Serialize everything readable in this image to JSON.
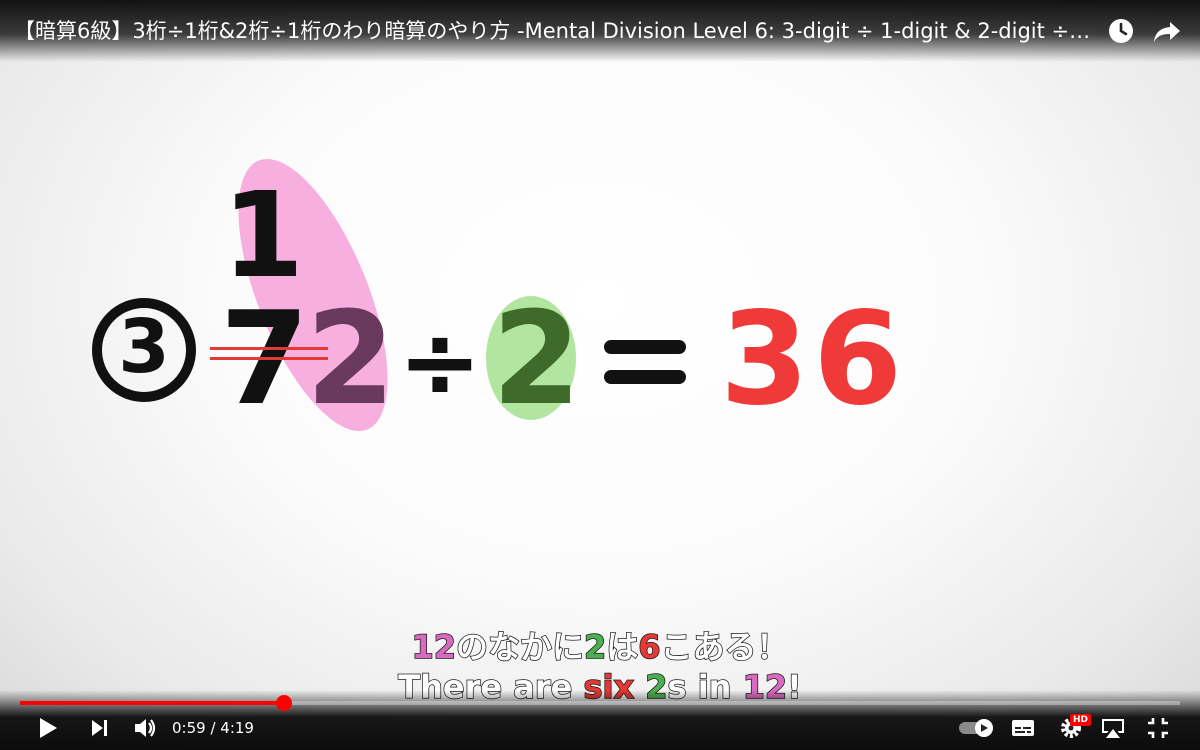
{
  "video": {
    "title": "【暗算6級】3桁÷1桁&2桁÷1桁のわり暗算のやり方 -Mental Division Level 6: 3-digit ÷ 1-digit & 2-digit ÷ 1-di..."
  },
  "slide": {
    "problem_number": "③",
    "top_digit": "1",
    "dividend_first": "7",
    "dividend_second": "2",
    "divide_sign": "÷",
    "divisor": "2",
    "equals_sign": "=",
    "answer": "36"
  },
  "subtitles": {
    "line1": [
      {
        "text": "12",
        "color": "pink"
      },
      {
        "text": "のなかに",
        "color": "white"
      },
      {
        "text": "2",
        "color": "green"
      },
      {
        "text": "は",
        "color": "white"
      },
      {
        "text": "6",
        "color": "red"
      },
      {
        "text": "こある！",
        "color": "white"
      }
    ],
    "line2": [
      {
        "text": "There are ",
        "color": "white"
      },
      {
        "text": "six",
        "color": "red"
      },
      {
        "text": " ",
        "color": "white"
      },
      {
        "text": "2",
        "color": "green"
      },
      {
        "text": "s in ",
        "color": "white"
      },
      {
        "text": "12",
        "color": "pink"
      },
      {
        "text": "!",
        "color": "white"
      }
    ]
  },
  "player": {
    "current_time": "0:59",
    "duration": "4:19",
    "time_display": "0:59 / 4:19",
    "progress_fraction": 0.228,
    "hd_badge": "HD",
    "icons": [
      "watch-later-icon",
      "share-icon",
      "play-icon",
      "next-icon",
      "volume-icon",
      "autoplay-toggle-icon",
      "subtitles-icon",
      "settings-icon",
      "airplay-icon",
      "exit-fullscreen-icon"
    ]
  },
  "colors": {
    "accent": "#ff0000",
    "answer": "#f03a3a",
    "pink_highlight": "#f5a3d8",
    "green_highlight": "#b5e8a0",
    "strike": "#e53935"
  }
}
